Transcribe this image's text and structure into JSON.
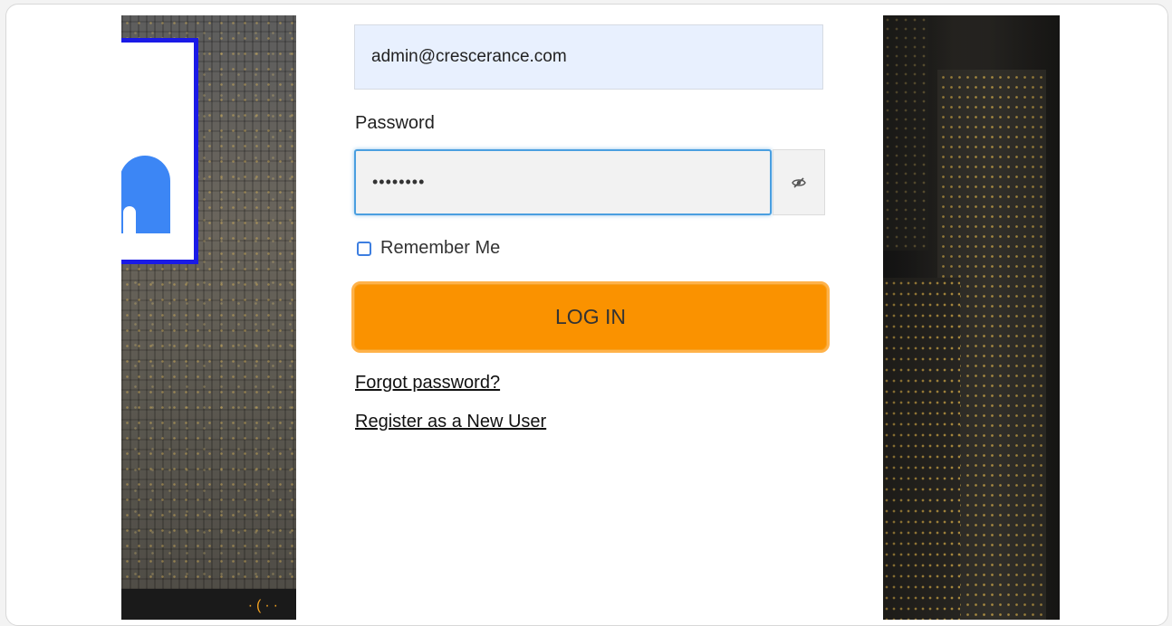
{
  "login_form": {
    "email_value": "admin@crescerance.com",
    "password_label": "Password",
    "password_value": "••••••••",
    "remember_label": "Remember Me",
    "login_button_label": "LOG IN",
    "forgot_link": "Forgot password?",
    "register_link": "Register as a New User"
  },
  "icons": {
    "password_toggle": "eye-slash-icon"
  },
  "colors": {
    "login_button": "#fa9200",
    "email_autofill_bg": "#e8f0fe",
    "focus_border": "#4a9fe0",
    "logo_border": "#1a1ae6",
    "logo_glyph": "#3c86f5"
  }
}
